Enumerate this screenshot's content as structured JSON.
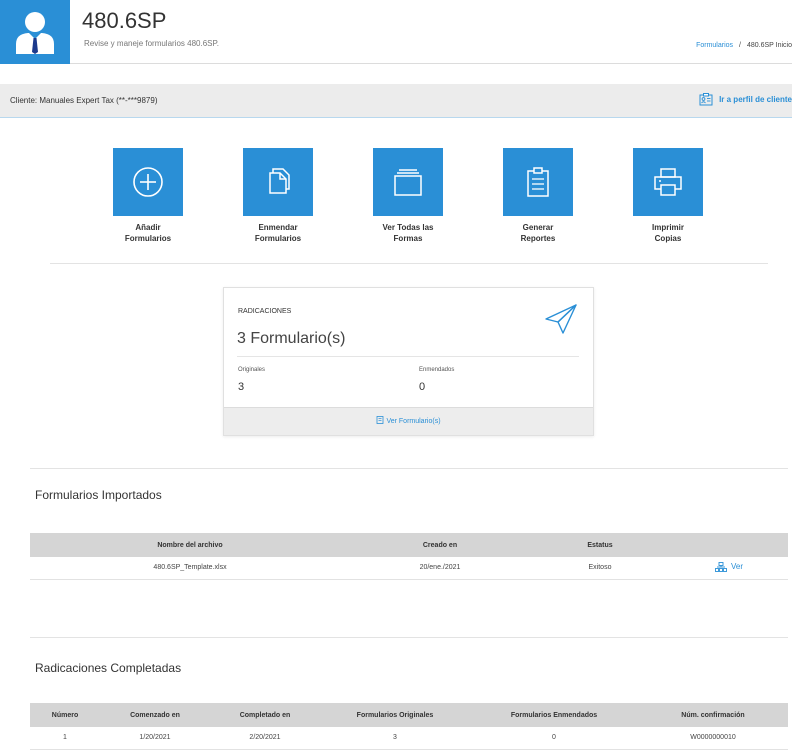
{
  "header": {
    "title": "480.6SP",
    "subtitle": "Revise y maneje formularios 480.6SP.",
    "breadcrumb": {
      "link": "Formularios",
      "separator": "/",
      "current": "480.6SP Inicio"
    }
  },
  "client_bar": {
    "client_text": "Cliente: Manuales Expert Tax (**-***9879)",
    "profile_link": "Ir a perfil de cliente"
  },
  "actions": [
    {
      "label_line1": "Añadir",
      "label_line2": "Formularios",
      "icon": "plus-circle-icon"
    },
    {
      "label_line1": "Enmendar",
      "label_line2": "Formularios",
      "icon": "documents-icon"
    },
    {
      "label_line1": "Ver Todas las",
      "label_line2": "Formas",
      "icon": "folder-stack-icon"
    },
    {
      "label_line1": "Generar",
      "label_line2": "Reportes",
      "icon": "clipboard-icon"
    },
    {
      "label_line1": "Imprimir",
      "label_line2": "Copias",
      "icon": "printer-icon"
    }
  ],
  "summary": {
    "title": "RADICACIONES",
    "count": "3 Formulario(s)",
    "originals_label": "Originales",
    "originals_value": "3",
    "amended_label": "Enmendados",
    "amended_value": "0",
    "footer_link": "Ver Formulario(s)",
    "icon": "paper-plane-icon"
  },
  "imported": {
    "title": "Formularios Importados",
    "columns": [
      "Nombre del archivo",
      "Creado en",
      "Estatus",
      ""
    ],
    "rows": [
      {
        "file": "480.6SP_Template.xlsx",
        "created": "20/ene./2021",
        "status": "Exitoso",
        "action": "Ver"
      }
    ]
  },
  "completed": {
    "title": "Radicaciones Completadas",
    "columns": [
      "Número",
      "Comenzado en",
      "Completado en",
      "Formularios Originales",
      "Formularios Enmendados",
      "Núm. confirmación"
    ],
    "rows": [
      {
        "number": "1",
        "started": "1/20/2021",
        "completed": "2/20/2021",
        "originals": "3",
        "amended": "0",
        "confirmation": "W0000000010"
      }
    ]
  },
  "colors": {
    "accent": "#2a8fd6",
    "header_gray": "#d5d5d5",
    "bar_gray": "#ececec"
  }
}
